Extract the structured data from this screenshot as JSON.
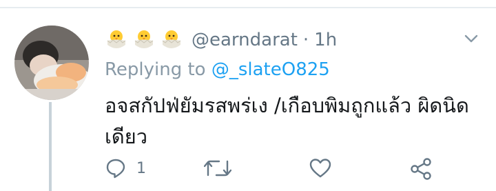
{
  "tweet": {
    "author_handle": "@earndarat",
    "separator": "·",
    "time_ago": "1h",
    "replying_prefix": "Replying to ",
    "replying_to": "@_slateO825",
    "text": "อจสกัปฟ่ยัมรสพร่เง /เกือบพิมถูกแล้ว ผิดนิดเดียว",
    "reply_count": "1",
    "name_emoji_icons": [
      "hatching-chick-icon",
      "hatching-chick-icon",
      "hatching-chick-icon"
    ]
  },
  "colors": {
    "secondary_text": "#657786",
    "accent": "#1da1f2",
    "main_text": "#14171a",
    "thread_line": "#c7d2d9",
    "divider": "#e6ecf0"
  }
}
